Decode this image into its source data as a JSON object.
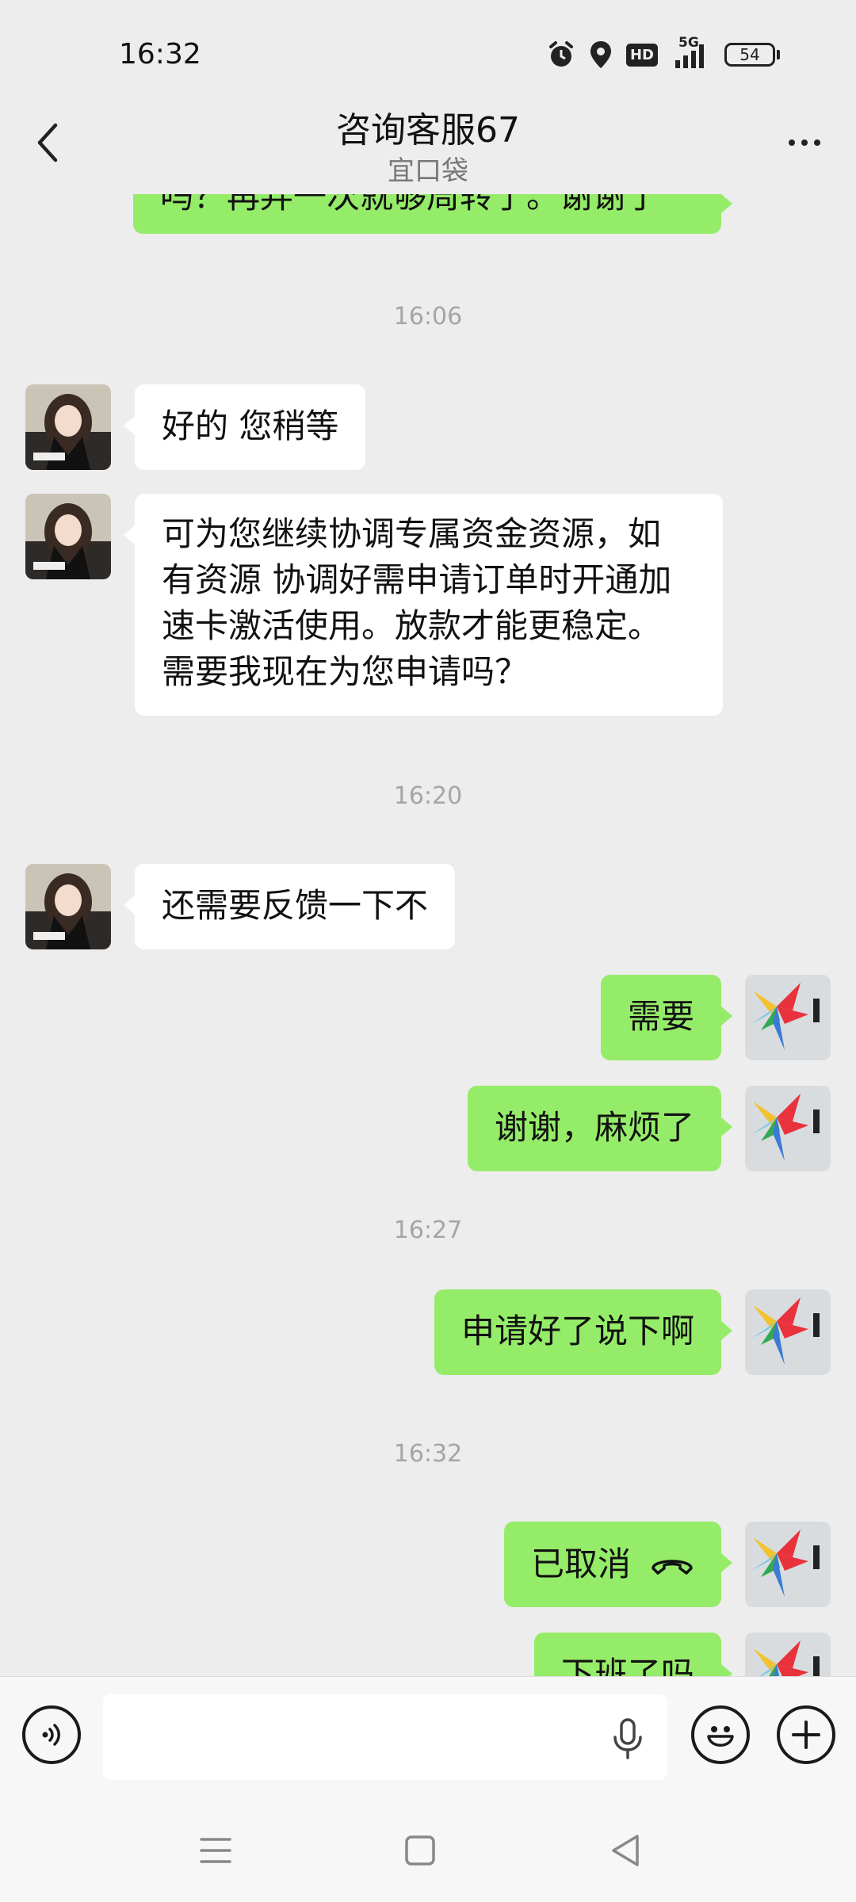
{
  "status": {
    "time": "16:32",
    "network": "5G",
    "hd_label": "HD",
    "battery": "54"
  },
  "header": {
    "title": "咨询客服67",
    "subtitle": "宜口袋"
  },
  "messages": {
    "top_partial": "吗？再弄一次就够周转了。谢谢了",
    "ts1": "16:06",
    "m1": "好的 您稍等",
    "m2_l1": "可为您继续协调专属资金资源，如",
    "m2_l2": "有资源 协调好需申请订单时开通加",
    "m2_l3": "速卡激活使用。放款才能更稳定。",
    "m2_l4": "需要我现在为您申请吗？",
    "ts2": "16:20",
    "m3": "还需要反馈一下不",
    "m4": "需要",
    "m5": "谢谢，麻烦了",
    "ts3": "16:27",
    "m6": "申请好了说下啊",
    "ts4": "16:32",
    "m7": "已取消",
    "m8_partial": "下班了吗"
  },
  "input": {
    "placeholder": ""
  },
  "colors": {
    "background": "#ededed",
    "sent_bubble": "#95ec69",
    "received_bubble": "#ffffff",
    "timestamp": "#a5a5a5"
  }
}
